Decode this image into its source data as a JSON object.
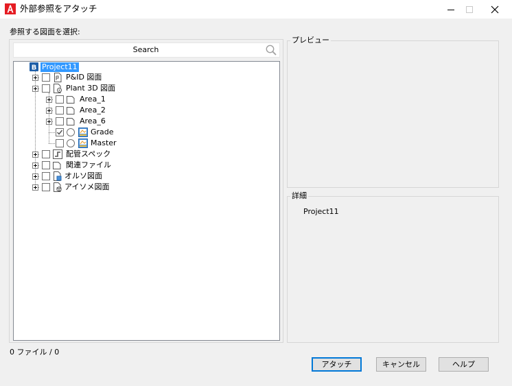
{
  "window": {
    "title": "外部参照をアタッチ",
    "minimize_glyph": "—",
    "maximize_glyph": "☐",
    "close_glyph": "✕"
  },
  "select_label": "参照する図面を選択:",
  "search": {
    "placeholder": "Search"
  },
  "tree": {
    "root": "Project11",
    "items": [
      {
        "label": "P&ID 図面",
        "icon": "pid-drawing-icon"
      },
      {
        "label": "Plant 3D 図面",
        "icon": "plant3d-drawing-icon"
      },
      {
        "label": "Area_1",
        "icon": "folder-icon"
      },
      {
        "label": "Area_2",
        "icon": "folder-icon"
      },
      {
        "label": "Area_6",
        "icon": "folder-icon"
      },
      {
        "label": "Grade",
        "icon": "drawing-file-icon",
        "checked": true
      },
      {
        "label": "Master",
        "icon": "drawing-file-icon",
        "checked": false
      },
      {
        "label": "配管スペック",
        "icon": "pipe-spec-icon"
      },
      {
        "label": "関連ファイル",
        "icon": "folder-icon"
      },
      {
        "label": "オルソ図面",
        "icon": "ortho-drawing-icon"
      },
      {
        "label": "アイソメ図面",
        "icon": "iso-drawing-icon"
      }
    ]
  },
  "preview": {
    "title": "プレビュー"
  },
  "details": {
    "title": "詳細",
    "value": "Project11"
  },
  "status": "0 ファイル / 0",
  "buttons": {
    "attach": "アタッチ",
    "cancel": "キャンセル",
    "help": "ヘルプ"
  },
  "colors": {
    "selection": "#3399ff",
    "accent": "#0078d7",
    "app_icon": "#e51c23"
  }
}
